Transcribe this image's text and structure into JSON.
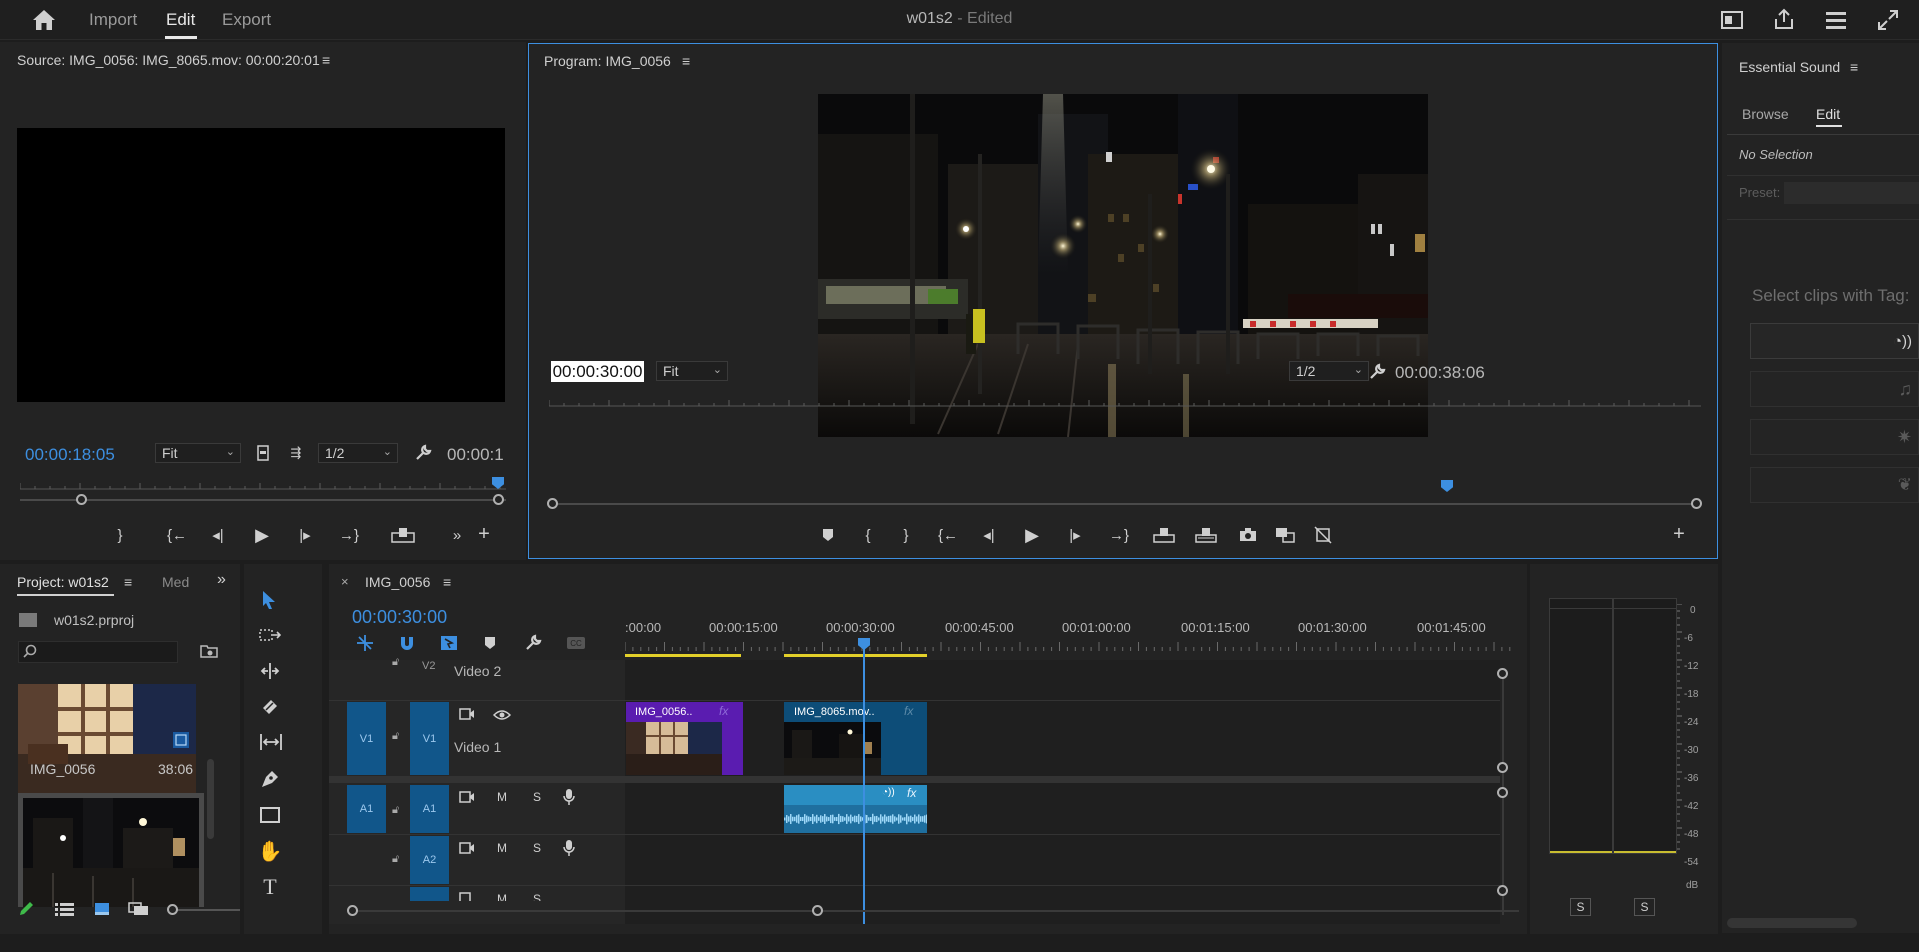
{
  "topbar": {
    "home_icon": "home-icon",
    "tabs": [
      "Import",
      "Edit",
      "Export"
    ],
    "project_name": "w01s2",
    "edited_label": "- Edited"
  },
  "source_monitor": {
    "title": "Source: IMG_0056: IMG_8065.mov: 00:00:20:01",
    "timecode": "00:00:18:05",
    "fit": "Fit",
    "resolution": "1/2",
    "duration": "00:00:1"
  },
  "program_monitor": {
    "title": "Program: IMG_0056",
    "timecode": "00:00:30:00",
    "fit": "Fit",
    "resolution": "1/2",
    "duration": "00:00:38:06",
    "playhead_fraction": 0.78
  },
  "essential_sound": {
    "title": "Essential Sound",
    "tabs": [
      "Browse",
      "Edit"
    ],
    "no_selection": "No Selection",
    "preset_label": "Preset:",
    "select_clips_label": "Select clips with Tag:"
  },
  "project_panel": {
    "title": "Project: w01s2",
    "secondary_tab": "Med",
    "file": "w01s2.prproj",
    "items": [
      {
        "name": "IMG_0056",
        "duration": "38:06"
      }
    ]
  },
  "timeline": {
    "sequence_name": "IMG_0056",
    "timecode": "00:00:30:00",
    "ruler_labels": [
      ":00:00",
      "00:00:15:00",
      "00:00:30:00",
      "00:00:45:00",
      "00:01:00:00",
      "00:01:15:00",
      "00:01:30:00",
      "00:01:45:00"
    ],
    "tracks": {
      "v2": {
        "tag": "V2",
        "name": "Video 2"
      },
      "v1": {
        "tag": "V1",
        "source_tag": "V1",
        "name": "Video 1"
      },
      "a1": {
        "tag": "A1",
        "source_tag": "A1",
        "m": "M",
        "s": "S"
      },
      "a2": {
        "tag": "A2",
        "m": "M",
        "s": "S"
      },
      "a3": {
        "m": "M",
        "s": "S"
      }
    },
    "clips": [
      {
        "name": "IMG_0056..",
        "fx": "fx",
        "color": "#5a1cb0"
      },
      {
        "name": "IMG_8065.mov..",
        "fx": "fx",
        "color": "#0d4d78"
      }
    ],
    "audio_clip_fx": "fx"
  },
  "audio_meter": {
    "labels": [
      "0",
      "-6",
      "-12",
      "-18",
      "-24",
      "-30",
      "-36",
      "-42",
      "-48",
      "-54",
      "dB"
    ],
    "solo_buttons": [
      "S",
      "S"
    ]
  },
  "colors": {
    "accent": "#3d8fe0",
    "track_blue": "#11568a",
    "clip_purple": "#5a1cb0",
    "clip_teal": "#0d4d78",
    "work_area": "#e3d02a"
  }
}
